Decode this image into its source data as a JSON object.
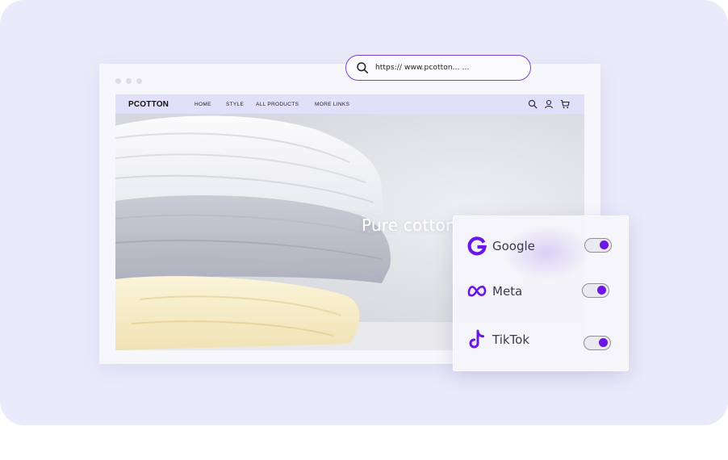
{
  "browser": {
    "url": "https:// www.pcotton... ...",
    "icons": [
      "search-icon",
      "user-icon",
      "cart-icon"
    ]
  },
  "site": {
    "brand": "PCOTTON",
    "nav": [
      "HOME",
      "STYLE",
      "ALL PRODUCTS",
      "MORE LINKS"
    ],
    "hero_title": "Pure cotton"
  },
  "panel": {
    "items": [
      {
        "label": "Google",
        "icon": "google-logo-icon",
        "enabled": true
      },
      {
        "label": "Meta",
        "icon": "meta-logo-icon",
        "enabled": true
      },
      {
        "label": "TikTok",
        "icon": "tiktok-logo-icon",
        "enabled": true
      }
    ]
  },
  "colors": {
    "accent": "#6a16e6",
    "backdrop": "#ebeafa",
    "navbar": "#e1e0fb"
  }
}
